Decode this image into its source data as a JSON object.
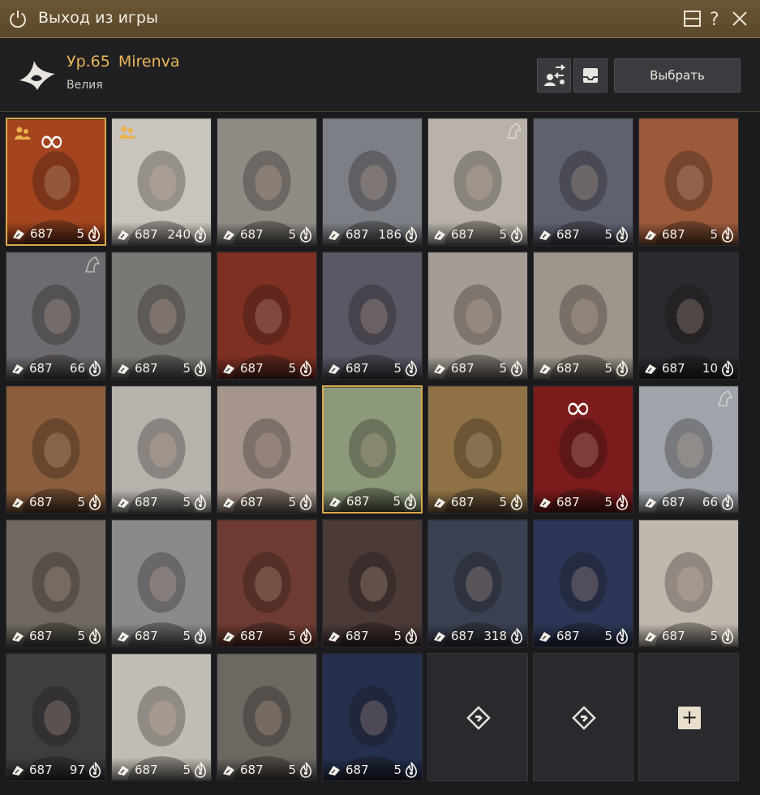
{
  "window": {
    "title": "Выход из игры"
  },
  "character": {
    "level": "Ур.65",
    "name": "Mirenva",
    "server": "Велия"
  },
  "header": {
    "select_label": "Выбрать"
  },
  "colors": {
    "accent": "#e9b558",
    "titlebar": "#5f4c2f",
    "selected_border": "#d9a94a"
  },
  "cards": [
    {
      "ilvl": "687",
      "count": "5",
      "bg": "#a4451f",
      "selected": true,
      "party": true,
      "infinity": true
    },
    {
      "ilvl": "687",
      "count": "240",
      "bg": "#c9c4bd",
      "party": true
    },
    {
      "ilvl": "687",
      "count": "5",
      "bg": "#8f8b85"
    },
    {
      "ilvl": "687",
      "count": "186",
      "bg": "#7c7f86"
    },
    {
      "ilvl": "687",
      "count": "5",
      "bg": "#b8b2aa",
      "horse": true
    },
    {
      "ilvl": "687",
      "count": "5",
      "bg": "#5e6270"
    },
    {
      "ilvl": "687",
      "count": "5",
      "bg": "#9c5a3a"
    },
    {
      "ilvl": "687",
      "count": "66",
      "bg": "#6d6b70",
      "horse": true
    },
    {
      "ilvl": "687",
      "count": "5",
      "bg": "#7a7875"
    },
    {
      "ilvl": "687",
      "count": "5",
      "bg": "#7e3022"
    },
    {
      "ilvl": "687",
      "count": "5",
      "bg": "#5b5866"
    },
    {
      "ilvl": "687",
      "count": "5",
      "bg": "#a49d96"
    },
    {
      "ilvl": "687",
      "count": "5",
      "bg": "#9d968c"
    },
    {
      "ilvl": "687",
      "count": "10",
      "bg": "#2b2a30"
    },
    {
      "ilvl": "687",
      "count": "5",
      "bg": "#8a5e3c"
    },
    {
      "ilvl": "687",
      "count": "5",
      "bg": "#b6b2ac"
    },
    {
      "ilvl": "687",
      "count": "5",
      "bg": "#a5958c"
    },
    {
      "ilvl": "687",
      "count": "5",
      "bg": "#8c9a7a",
      "selected": true
    },
    {
      "ilvl": "687",
      "count": "5",
      "bg": "#8e7145"
    },
    {
      "ilvl": "687",
      "count": "5",
      "bg": "#7b1b1b",
      "infinity": true
    },
    {
      "ilvl": "687",
      "count": "66",
      "bg": "#9ea4aa",
      "horse": true
    },
    {
      "ilvl": "687",
      "count": "5",
      "bg": "#6f6961"
    },
    {
      "ilvl": "687",
      "count": "5",
      "bg": "#8a8a8c"
    },
    {
      "ilvl": "687",
      "count": "5",
      "bg": "#6e3b33"
    },
    {
      "ilvl": "687",
      "count": "5",
      "bg": "#4b3a38"
    },
    {
      "ilvl": "687",
      "count": "318",
      "bg": "#3a4152"
    },
    {
      "ilvl": "687",
      "count": "5",
      "bg": "#2c3656"
    },
    {
      "ilvl": "687",
      "count": "5",
      "bg": "#c0b7ae"
    },
    {
      "ilvl": "687",
      "count": "97",
      "bg": "#3e3d40"
    },
    {
      "ilvl": "687",
      "count": "5",
      "bg": "#c1bcb4"
    },
    {
      "ilvl": "687",
      "count": "5",
      "bg": "#6d6862"
    },
    {
      "ilvl": "687",
      "count": "5",
      "bg": "#25304e"
    },
    {
      "empty": true,
      "slot": "locked"
    },
    {
      "empty": true,
      "slot": "locked"
    },
    {
      "empty": true,
      "slot": "add",
      "plus": "+"
    }
  ]
}
